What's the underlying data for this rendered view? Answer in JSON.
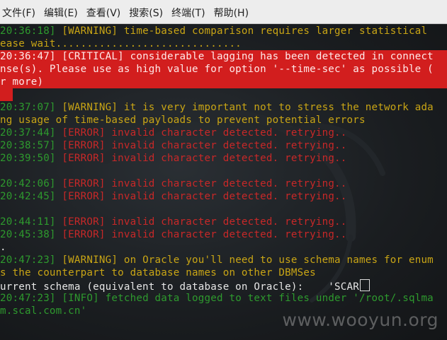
{
  "menubar": {
    "items": [
      "文件(F)",
      "编辑(E)",
      "查看(V)",
      "搜索(S)",
      "终端(T)",
      "帮助(H)"
    ]
  },
  "terminal": {
    "l1_ts": "20:36:18]",
    "l1_rest": " [WARNING] time-based comparison requires larger statistical",
    "l2": "ease wait..............................",
    "l3_ts": "20:36:47]",
    "l3_rest": " [CRITICAL] considerable lagging has been detected in connect",
    "l4": "nse(s). Please use as high value for option '--time-sec' as possible (",
    "l5": "r more)",
    "l6_ts": "20:37:07]",
    "l6_rest": " [WARNING] it is very important not to stress the network ada",
    "l7": "ng usage of time-based payloads to prevent potential errors",
    "err_text": " [ERROR] invalid character detected. retrying..",
    "e1_ts": "20:37:44]",
    "e2_ts": "20:38:57]",
    "e3_ts": "20:39:50]",
    "e4_ts": "20:42:06]",
    "e5_ts": "20:42:45]",
    "e6_ts": "20:44:11]",
    "e7_ts": "20:45:38]",
    "l8": ".",
    "l9_ts": "20:47:23]",
    "l9_rest": " [WARNING] on Oracle you'll need to use schema names for enum",
    "l10": "s the counterpart to database names on other DBMSes",
    "l11": "urrent schema (equivalent to database on Oracle):    'SCAR",
    "l12_ts": "20:47:23]",
    "l12_rest": " [INFO] fetched data logged to text files under '/root/.sqlma",
    "l13": "m.scal.com.cn'"
  },
  "watermark": "www.wooyun.org"
}
